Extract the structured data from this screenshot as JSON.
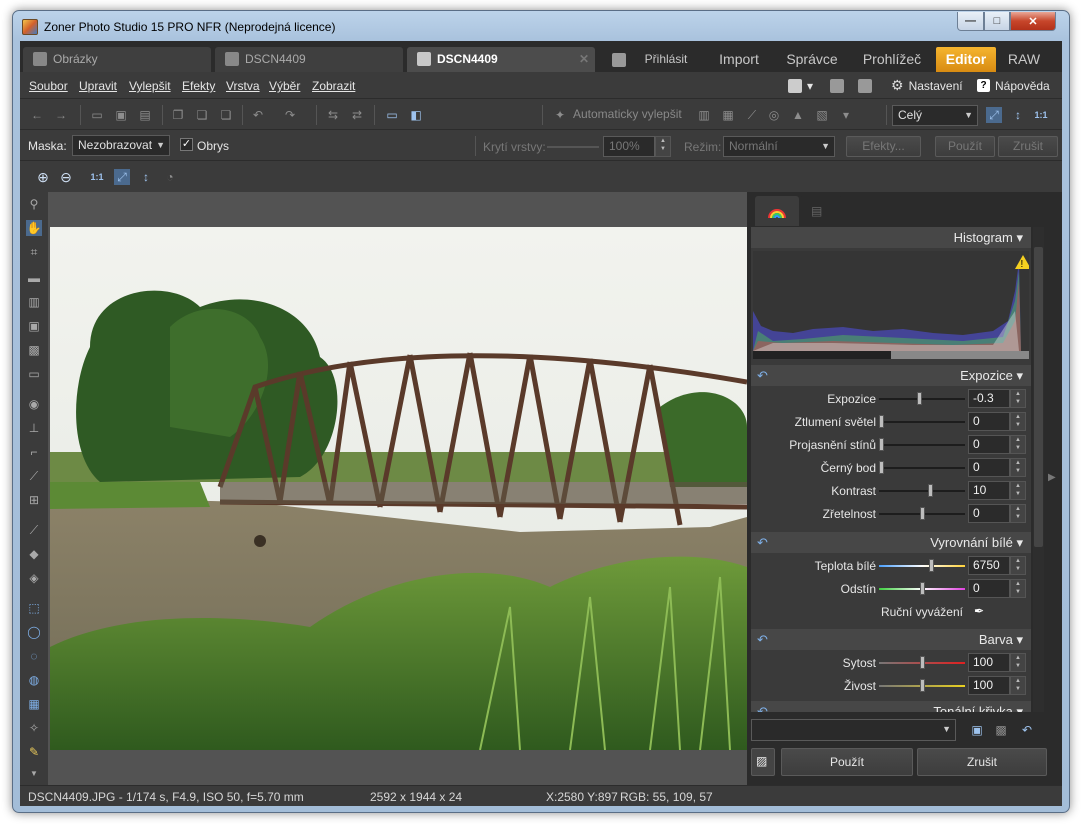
{
  "window": {
    "title": "Zoner Photo Studio 15 PRO NFR (Neprodejná licence)",
    "minimize": "—",
    "maximize": "□",
    "close": "✕"
  },
  "tabs": [
    {
      "label": "Obrázky",
      "icon": "folder-icon"
    },
    {
      "label": "DSCN4409",
      "icon": "viewer-icon"
    },
    {
      "label": "DSCN4409",
      "icon": "editor-icon",
      "close": "✕"
    }
  ],
  "modules": {
    "login": "Přihlásit",
    "import": "Import",
    "manager": "Správce",
    "viewer": "Prohlížeč",
    "editor": "Editor",
    "raw": "RAW"
  },
  "menu": [
    "Soubor",
    "Upravit",
    "Vylepšit",
    "Efekty",
    "Vrstva",
    "Výběr",
    "Zobrazit"
  ],
  "menu_right": {
    "settings": "Nastavení",
    "help": "Nápověda",
    "help_icon": "?"
  },
  "toolbar": {
    "auto_enhance": "Automaticky vylepšit",
    "view_select": "Celý",
    "zoom_1to1": "1:1"
  },
  "options": {
    "mask_label": "Maska:",
    "mask_value": "Nezobrazovat",
    "outline_label": "Obrys",
    "outline_checked": true,
    "opacity_label": "Krytí vrstvy:",
    "opacity_value": "100%",
    "mode_label": "Režim:",
    "mode_value": "Normální",
    "effects_button": "Efekty...",
    "apply_button": "Použít",
    "cancel_button": "Zrušit"
  },
  "zoombar": {
    "zoom_1to1": "1:1"
  },
  "panel": {
    "histogram": {
      "title": "Histogram",
      "warning": "!"
    },
    "exposure": {
      "title": "Expozice",
      "rows": [
        {
          "label": "Expozice",
          "value": "-0.3",
          "level": 0.47
        },
        {
          "label": "Ztlumení světel",
          "value": "0",
          "level": 0.0
        },
        {
          "label": "Projasnění stínů",
          "value": "0",
          "level": 0.0
        },
        {
          "label": "Černý bod",
          "value": "0",
          "level": 0.0
        },
        {
          "label": "Kontrast",
          "value": "10",
          "level": 0.6
        },
        {
          "label": "Zřetelnost",
          "value": "0",
          "level": 0.5
        }
      ]
    },
    "white_balance": {
      "title": "Vyrovnání bílé",
      "rows": [
        {
          "label": "Teplota bílé",
          "value": "6750",
          "level": 0.62
        },
        {
          "label": "Odstín",
          "value": "0",
          "level": 0.5
        }
      ],
      "manual": "Ruční vyvážení"
    },
    "color": {
      "title": "Barva",
      "rows": [
        {
          "label": "Sytost",
          "value": "100",
          "level": 0.5
        },
        {
          "label": "Živost",
          "value": "100",
          "level": 0.5
        }
      ]
    },
    "tone_curve": {
      "title": "Tonální křivka"
    },
    "apply": "Použít",
    "cancel": "Zrušit"
  },
  "status": {
    "file": "DSCN4409.JPG - 1/174 s, F4.9, ISO 50, f=5.70 mm",
    "dims": "2592 x 1944 x 24",
    "coords": "X:2580 Y:897",
    "rgb": "RGB: 55, 109, 57"
  },
  "colors": {
    "editor_tab": "#e39a1c",
    "background": "#3b3b3b",
    "panel_bg": "#2b2b2b",
    "accent": "#7fb0e8"
  }
}
